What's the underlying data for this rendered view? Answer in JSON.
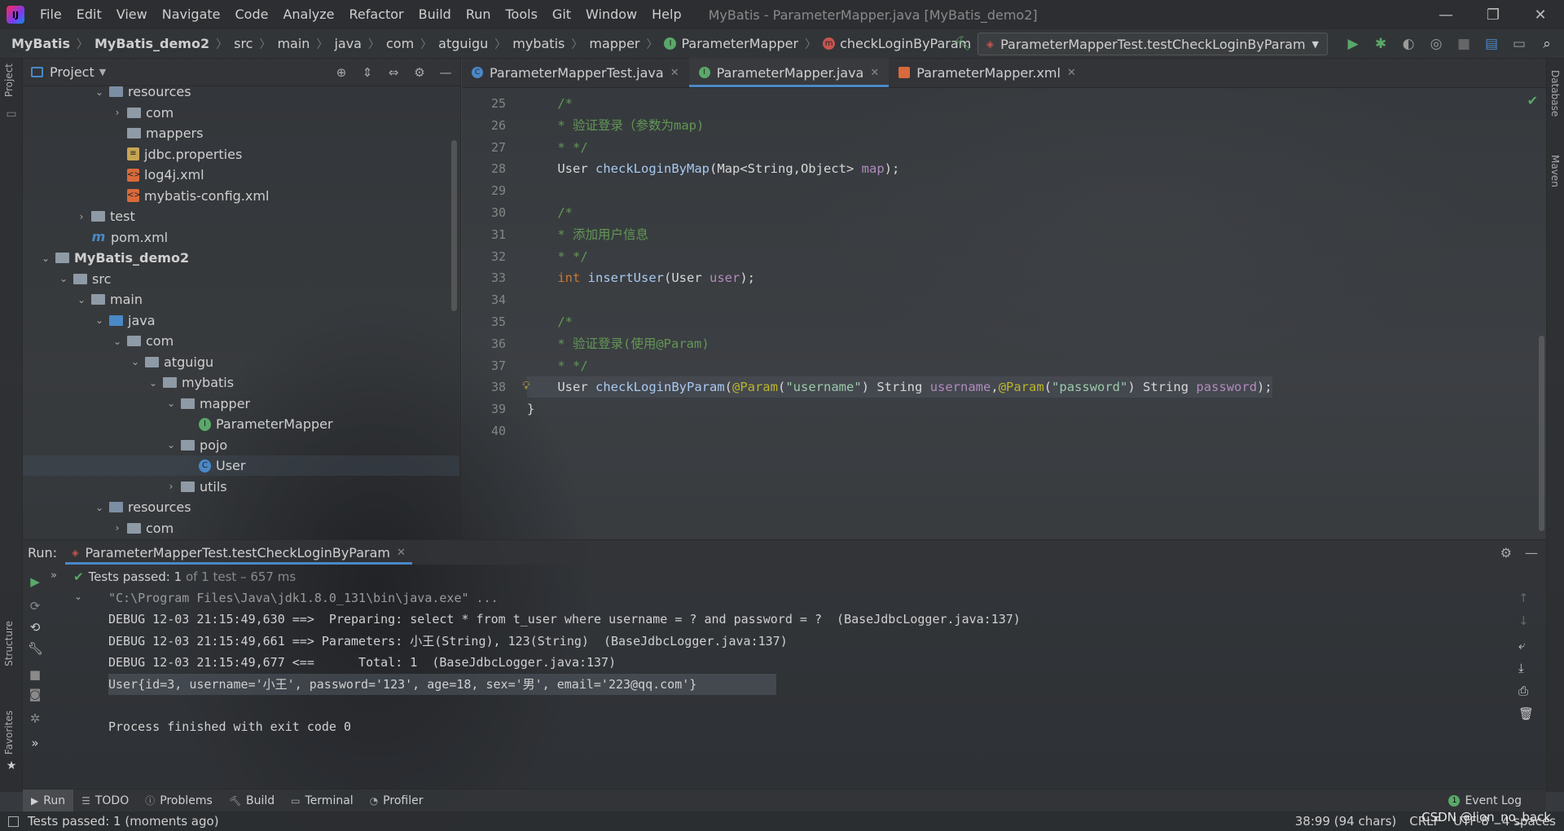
{
  "menubar": {
    "items": [
      "File",
      "Edit",
      "View",
      "Navigate",
      "Code",
      "Analyze",
      "Refactor",
      "Build",
      "Run",
      "Tools",
      "Git",
      "Window",
      "Help"
    ],
    "window_title": "MyBatis - ParameterMapper.java [MyBatis_demo2]"
  },
  "breadcrumb": [
    "MyBatis",
    "MyBatis_demo2",
    "src",
    "main",
    "java",
    "com",
    "atguigu",
    "mybatis",
    "mapper",
    "ParameterMapper",
    "checkLoginByParam"
  ],
  "run_config": "ParameterMapperTest.testCheckLoginByParam",
  "left_stripe": {
    "project": "Project",
    "structure": "Structure",
    "favorites": "Favorites"
  },
  "right_stripe": {
    "database": "Database",
    "maven": "Maven"
  },
  "project_panel": {
    "title": "Project",
    "tree": [
      {
        "label": "resources",
        "depth": 4,
        "icon": "folder-res",
        "open": true
      },
      {
        "label": "com",
        "depth": 5,
        "icon": "folder",
        "open": false,
        "chev": true
      },
      {
        "label": "mappers",
        "depth": 5,
        "icon": "folder"
      },
      {
        "label": "jdbc.properties",
        "depth": 5,
        "icon": "props"
      },
      {
        "label": "log4j.xml",
        "depth": 5,
        "icon": "xml"
      },
      {
        "label": "mybatis-config.xml",
        "depth": 5,
        "icon": "xml"
      },
      {
        "label": "test",
        "depth": 3,
        "icon": "folder",
        "open": false,
        "chev": true
      },
      {
        "label": "pom.xml",
        "depth": 3,
        "icon": "pom"
      },
      {
        "label": "MyBatis_demo2",
        "depth": 1,
        "icon": "module",
        "open": true,
        "bold": true
      },
      {
        "label": "src",
        "depth": 2,
        "icon": "folder",
        "open": true
      },
      {
        "label": "main",
        "depth": 3,
        "icon": "folder",
        "open": true
      },
      {
        "label": "java",
        "depth": 4,
        "icon": "folder-blue",
        "open": true
      },
      {
        "label": "com",
        "depth": 5,
        "icon": "folder",
        "open": true
      },
      {
        "label": "atguigu",
        "depth": 6,
        "icon": "folder",
        "open": true
      },
      {
        "label": "mybatis",
        "depth": 7,
        "icon": "folder",
        "open": true
      },
      {
        "label": "mapper",
        "depth": 8,
        "icon": "folder",
        "open": true
      },
      {
        "label": "ParameterMapper",
        "depth": 9,
        "icon": "interface"
      },
      {
        "label": "pojo",
        "depth": 8,
        "icon": "folder",
        "open": true
      },
      {
        "label": "User",
        "depth": 9,
        "icon": "class",
        "selected": true
      },
      {
        "label": "utils",
        "depth": 8,
        "icon": "folder",
        "open": false,
        "chev": true
      },
      {
        "label": "resources",
        "depth": 4,
        "icon": "folder-res",
        "open": true
      },
      {
        "label": "com",
        "depth": 5,
        "icon": "folder",
        "open": false,
        "chev": true
      }
    ]
  },
  "editor": {
    "tabs": [
      {
        "label": "ParameterMapperTest.java",
        "icon": "C",
        "active": false
      },
      {
        "label": "ParameterMapper.java",
        "icon": "I",
        "active": true
      },
      {
        "label": "ParameterMapper.xml",
        "icon": "X",
        "active": false
      }
    ],
    "lines": [
      {
        "no": "25",
        "html": "<span class='cm'>    /*</span>"
      },
      {
        "no": "26",
        "html": "<span class='cm'>    * 验证登录（参数为map)</span>"
      },
      {
        "no": "27",
        "html": "<span class='cm'>    * */</span>"
      },
      {
        "no": "28",
        "html": "    <span class='ty'>User</span> <span class='fn'>checkLoginByMap</span><span class='pn'>(</span><span class='ty'>Map&lt;String,Object&gt;</span> <span class='pr'>map</span><span class='pn'>);</span>"
      },
      {
        "no": "29",
        "html": ""
      },
      {
        "no": "30",
        "html": "<span class='cm'>    /*</span>"
      },
      {
        "no": "31",
        "html": "<span class='cm'>    * 添加用户信息</span>"
      },
      {
        "no": "32",
        "html": "<span class='cm'>    * */</span>"
      },
      {
        "no": "33",
        "html": "    <span class='kw'>int</span> <span class='fn'>insertUser</span><span class='pn'>(</span><span class='ty'>User</span> <span class='pr'>user</span><span class='pn'>);</span>"
      },
      {
        "no": "34",
        "html": ""
      },
      {
        "no": "35",
        "html": "<span class='cm'>    /*</span>"
      },
      {
        "no": "36",
        "html": "<span class='cm'>    * 验证登录(使用@Param)</span>"
      },
      {
        "no": "37",
        "html": "<span class='cm'>    * */</span>"
      },
      {
        "no": "38",
        "html": "    <span class='ty'>User</span> <span class='fn'>checkLoginByParam</span><span class='pn'>(</span><span class='an'>@Param</span><span class='pn'>(</span><span class='st'>\"username\"</span><span class='pn'>)</span> <span class='ty'>String</span> <span class='pr'>username</span><span class='pn'>,</span><span class='an'>@Param</span><span class='pn'>(</span><span class='st'>\"password\"</span><span class='pn'>)</span> <span class='ty'>String</span> <span class='pr'>password</span><span class='pn'>);</span>",
        "highlight": true
      },
      {
        "no": "39",
        "html": "<span class='pn'>}</span>"
      },
      {
        "no": "40",
        "html": ""
      }
    ]
  },
  "run_panel": {
    "label": "Run:",
    "tab": "ParameterMapperTest.testCheckLoginByParam",
    "tests_passed": "Tests passed: 1",
    "tests_detail": "of 1 test – 657 ms",
    "console": [
      {
        "text": "\"C:\\Program Files\\Java\\jdk1.8.0_131\\bin\\java.exe\" ...",
        "dim": true
      },
      {
        "text": "DEBUG 12-03 21:15:49,630 ==>  Preparing: select * from t_user where username = ? and password = ?  (BaseJdbcLogger.java:137)"
      },
      {
        "text": "DEBUG 12-03 21:15:49,661 ==> Parameters: 小王(String), 123(String)  (BaseJdbcLogger.java:137)"
      },
      {
        "text": "DEBUG 12-03 21:15:49,677 <==      Total: 1  (BaseJdbcLogger.java:137)"
      },
      {
        "text": "User{id=3, username='小王', password='123', age=18, sex='男', email='223@qq.com'}",
        "selected": true
      },
      {
        "text": ""
      },
      {
        "text": "Process finished with exit code 0"
      }
    ]
  },
  "tool_tabs": [
    "Run",
    "TODO",
    "Problems",
    "Build",
    "Terminal",
    "Profiler"
  ],
  "event_log": "Event Log",
  "event_log_count": "1",
  "status": {
    "left": "Tests passed: 1 (moments ago)",
    "position": "38:99 (94 chars)",
    "line_sep": "CRLF",
    "encoding": "UTF-8",
    "indent": "4 spaces"
  },
  "watermark": "CSDN @lion_no_back"
}
